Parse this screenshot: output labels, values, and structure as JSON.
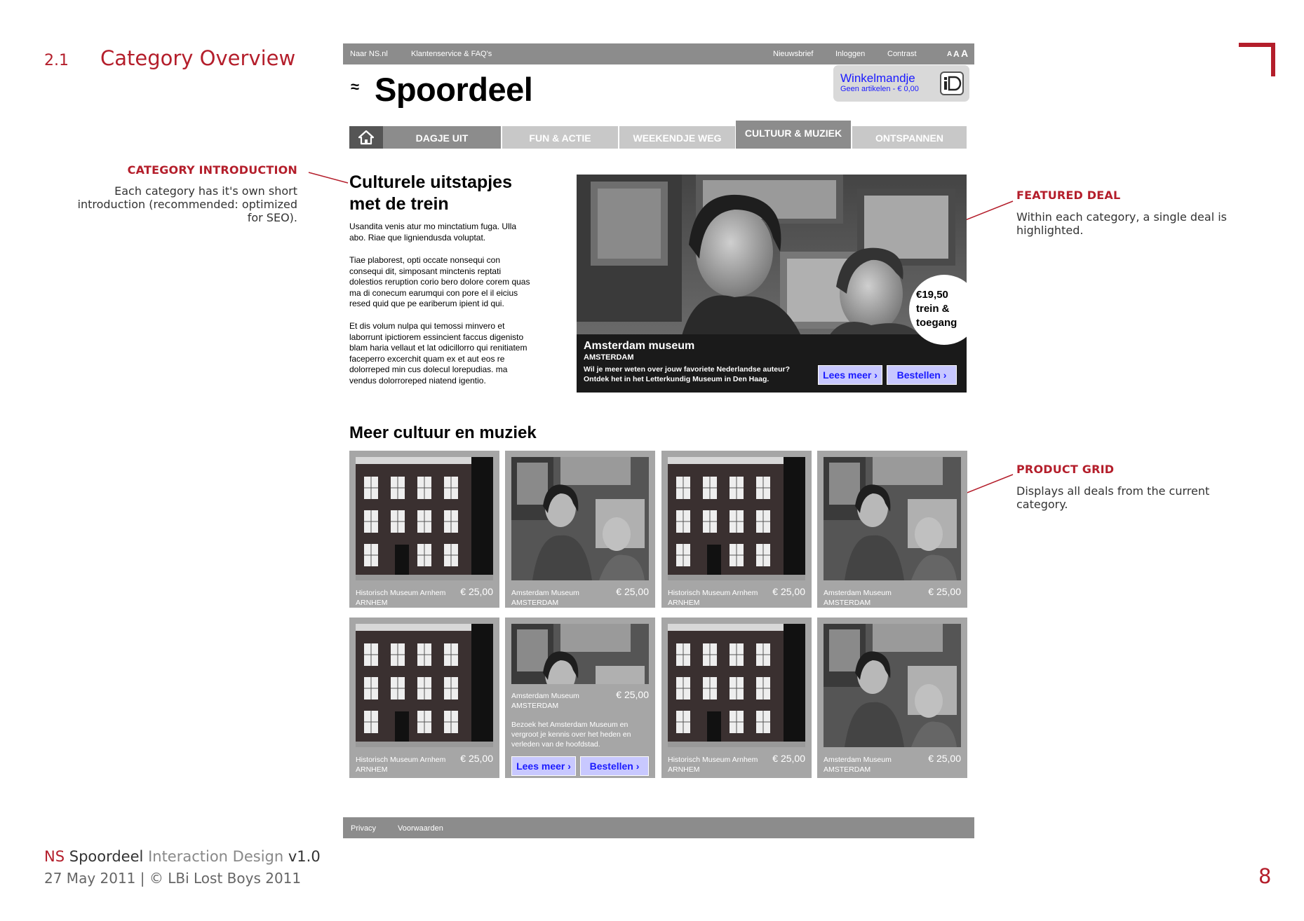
{
  "doc": {
    "section_number": "2.1",
    "section_title": "Category Overview",
    "footer_ns": "NS",
    "footer_spoordeel": "Spoordeel",
    "footer_id": "Interaction Design",
    "footer_version": "v1.0",
    "footer_date": "27 May 2011  |  © LBi Lost Boys 2011",
    "page_number": "8",
    "accent_color": "#b41e2b"
  },
  "annotations": {
    "category_intro": {
      "title": "CATEGORY INTRODUCTION",
      "lines": [
        "Each category has it's own short",
        "introduction (recommended: optimized",
        "for SEO)."
      ]
    },
    "featured_deal": {
      "title": "FEATURED DEAL",
      "lines": [
        "Within each category, a single deal is",
        "highlighted."
      ]
    },
    "product_grid": {
      "title": "PRODUCT GRID",
      "lines": [
        "Displays all deals from the current",
        "category."
      ]
    }
  },
  "site": {
    "topbar": {
      "left_links": [
        "Naar NS.nl",
        "Klantenservice & FAQ's"
      ],
      "right_links": [
        "Nieuwsbrief",
        "Inloggen",
        "Contrast"
      ],
      "font_size_labels": [
        "A",
        "A",
        "A"
      ]
    },
    "logo": {
      "text": "Spoordeel",
      "mark": "≈"
    },
    "cart": {
      "title": "Winkelmandje",
      "subtitle": "Geen artikelen - € 0,00",
      "icon": "ideal-icon"
    },
    "nav": {
      "home_icon": "home-icon",
      "items": [
        "DAGJE UIT",
        "FUN & ACTIE",
        "WEEKENDJE WEG",
        "CULTUUR & MUZIEK",
        "ONTSPANNEN"
      ],
      "active": "CULTUUR & MUZIEK"
    },
    "intro": {
      "heading_line1": "Culturele uitstapjes",
      "heading_line2": "met de trein",
      "paragraphs": [
        [
          "Usandita venis atur mo minctatium fuga. Ulla",
          "abo. Riae que ligniendusda voluptat."
        ],
        [
          "Tiae plaborest, opti occate nonsequi con",
          "consequi dit, simposant minctenis reptati",
          "dolestios reruption corio bero dolore corem quas",
          "ma di conecum earumqui con pore el il eicius",
          "resed quid que pe eariberum ipient id qui."
        ],
        [
          "Et dis volum nulpa qui temossi minvero et",
          "laborrunt ipictiorem essincient faccus digenisto",
          "blam haria vellaut et lat odicillorro qui renitiatem",
          "faceperro excerchit quam ex et aut eos re",
          "dolorreped min cus dolecul lorepudias. ma",
          "vendus dolorroreped niatend igentio."
        ]
      ]
    },
    "featured": {
      "title": "Amsterdam museum",
      "city": "AMSTERDAM",
      "desc_line1": "Wil je meer weten over jouw favoriete Nederlandse auteur?",
      "desc_line2": "Ontdek het in het Letterkundig Museum in Den Haag.",
      "price_line1": "€19,50",
      "price_line2": "trein &",
      "price_line3": "toegang",
      "more_label": "Lees meer ›",
      "order_label": "Bestellen ›"
    },
    "more_heading": "Meer cultuur en muziek",
    "products": [
      {
        "name": "Historisch Museum Arnhem",
        "city": "ARNHEM",
        "price": "€ 25,00",
        "image": "building"
      },
      {
        "name": "Amsterdam Museum",
        "city": "AMSTERDAM",
        "price": "€ 25,00",
        "image": "museum"
      },
      {
        "name": "Historisch Museum Arnhem",
        "city": "ARNHEM",
        "price": "€ 25,00",
        "image": "building"
      },
      {
        "name": "Amsterdam Museum",
        "city": "AMSTERDAM",
        "price": "€ 25,00",
        "image": "museum"
      },
      {
        "name": "Historisch Museum Arnhem",
        "city": "ARNHEM",
        "price": "€ 25,00",
        "image": "building"
      },
      {
        "name": "Amsterdam Museum",
        "city": "AMSTERDAM",
        "price": "€ 25,00",
        "image": "museum",
        "expanded": true,
        "desc": [
          "Bezoek het Amsterdam Museum en",
          "vergroot je kennis over het heden en",
          "verleden van de hoofdstad."
        ],
        "more_label": "Lees meer ›",
        "order_label": "Bestellen ›"
      },
      {
        "name": "Historisch Museum Arnhem",
        "city": "ARNHEM",
        "price": "€ 25,00",
        "image": "building"
      },
      {
        "name": "Amsterdam Museum",
        "city": "AMSTERDAM",
        "price": "€ 25,00",
        "image": "museum"
      }
    ],
    "footer_links": [
      "Privacy",
      "Voorwaarden"
    ],
    "button_color": "#c8c8ff",
    "link_color": "#1a1aff"
  }
}
